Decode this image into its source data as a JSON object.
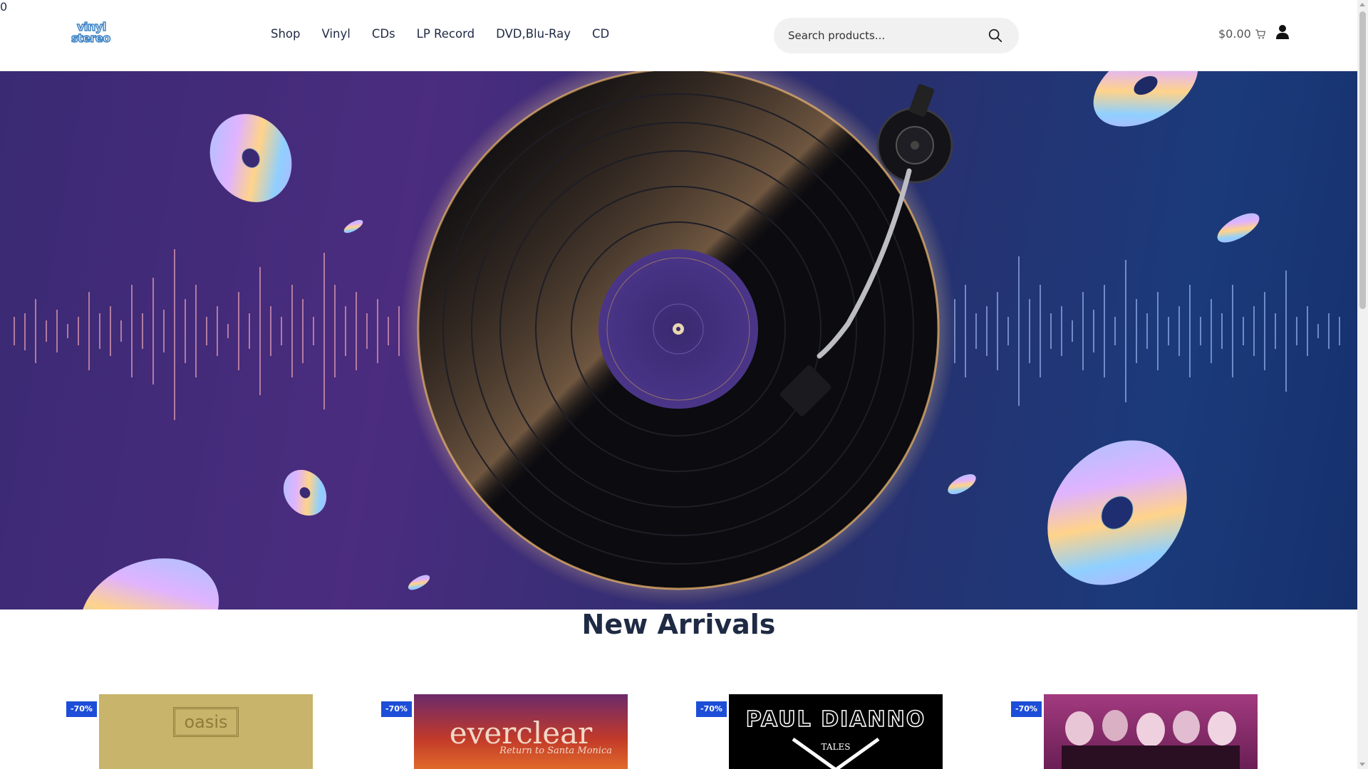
{
  "header": {
    "logo": {
      "line1": "vinyl",
      "line2": "stereo"
    },
    "nav": [
      "Shop",
      "Vinyl",
      "CDs",
      "LP Record",
      "DVD,Blu-Ray",
      "CD"
    ],
    "search": {
      "placeholder": "Search products...",
      "icon": "search-icon"
    },
    "cart": {
      "total": "$0.00",
      "count": "0",
      "icon": "cart-icon"
    },
    "user_icon": "user-icon"
  },
  "hero": {
    "image": "turntable-vinyl-record-with-cds",
    "colors": {
      "purple": "#4b2c7f",
      "blue": "#1b3a7a",
      "glow": "#f4c27a"
    }
  },
  "new_arrivals": {
    "title": "New Arrivals",
    "products": [
      {
        "discount": "-70%",
        "cover_text": "oasis",
        "cover_color": "#c8b46a"
      },
      {
        "discount": "-70%",
        "cover_text": "everclear",
        "cover_subtext": "Return to Santa Monica",
        "cover_color": "#8a2a22"
      },
      {
        "discount": "-70%",
        "cover_text": "PAUL DIANNO",
        "cover_subtext": "TALES",
        "cover_color": "#000000"
      },
      {
        "discount": "-70%",
        "cover_text": "",
        "cover_color": "#8a2a6b"
      }
    ]
  },
  "colors": {
    "accent": "#1d4ed8",
    "badge": "#e53935",
    "text": "#1f2a44"
  }
}
